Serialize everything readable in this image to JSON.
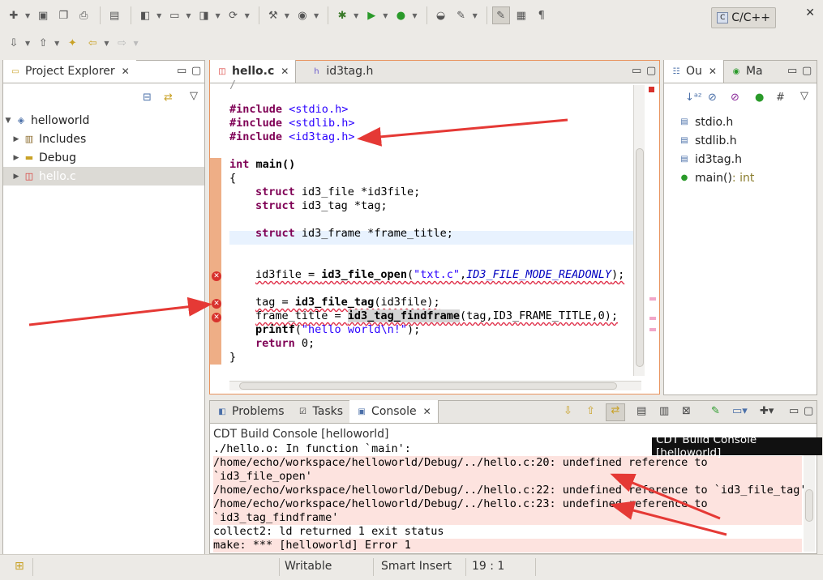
{
  "perspective": {
    "label": "C/C++"
  },
  "project_explorer": {
    "title": "Project Explorer",
    "tree": [
      {
        "label": "helloworld",
        "icon": "c-project-icon"
      },
      {
        "label": "Includes",
        "icon": "includes-icon"
      },
      {
        "label": "Debug",
        "icon": "folder-icon"
      },
      {
        "label": "hello.c",
        "icon": "c-file-error-icon"
      }
    ]
  },
  "editor": {
    "tabs": [
      {
        "label": "hello.c",
        "active": true
      },
      {
        "label": "id3tag.h",
        "active": false
      }
    ],
    "lines": {
      "inc1_kw": "#include",
      "inc1_file": "<stdio.h>",
      "inc2_kw": "#include",
      "inc2_file": "<stdlib.h>",
      "inc3_kw": "#include",
      "inc3_file": "<id3tag.h>",
      "main_kw": "int",
      "main_rest": " main()",
      "open_brace": "{",
      "s1_kw": "struct",
      "s1_rest": " id3_file *id3file;",
      "s2_kw": "struct",
      "s2_rest": " id3_tag *tag;",
      "s3_kw": "struct",
      "s3_rest": " id3_frame *frame_title;",
      "l1_a": "id3file = ",
      "l1_fn": "id3_file_open",
      "l1_b": "(",
      "l1_str": "\"txt.c\"",
      "l1_c": ",",
      "l1_it": "ID3_FILE_MODE_READONLY",
      "l1_d": ");",
      "l2_a": "tag = ",
      "l2_fn": "id3_file_tag",
      "l2_b": "(id3file);",
      "l3_a": "frame_title = ",
      "l3_fn": "id3_tag_findframe",
      "l3_b": "(tag,ID3_FRAME_TITLE,0);",
      "l4_fn": "printf",
      "l4_b": "(",
      "l4_str": "\"hello world\\n!\"",
      "l4_c": ");",
      "l5_kw": "return",
      "l5_rest": " 0;",
      "close_brace": "}"
    }
  },
  "outline": {
    "tabs": [
      {
        "label": "Ou"
      },
      {
        "label": "Ma"
      }
    ],
    "items": [
      {
        "label": "stdio.h",
        "type": ""
      },
      {
        "label": "stdlib.h",
        "type": ""
      },
      {
        "label": "id3tag.h",
        "type": ""
      },
      {
        "label": "main()",
        "type": " : int"
      }
    ]
  },
  "console": {
    "tabs": [
      {
        "label": "Problems"
      },
      {
        "label": "Tasks"
      },
      {
        "label": "Console"
      }
    ],
    "label": "CDT Build Console [helloworld]",
    "lines": [
      {
        "text": "./hello.o: In function `main':",
        "error": false
      },
      {
        "text": "/home/echo/workspace/helloworld/Debug/../hello.c:20: undefined reference to",
        "error": true
      },
      {
        "text": "`id3_file_open'",
        "error": true
      },
      {
        "text": "/home/echo/workspace/helloworld/Debug/../hello.c:22: undefined reference to `id3_file_tag'",
        "error": true
      },
      {
        "text": "/home/echo/workspace/helloworld/Debug/../hello.c:23: undefined reference to",
        "error": true
      },
      {
        "text": "`id3_tag_findframe'",
        "error": true
      },
      {
        "text": "collect2: ld returned 1 exit status",
        "error": false
      },
      {
        "text": "make: *** [helloworld] Error 1",
        "error": true
      }
    ],
    "tooltip": "CDT Build Console [helloworld]"
  },
  "status": {
    "writable": "Writable",
    "insert": "Smart Insert",
    "position": "19 : 1"
  },
  "colors": {
    "error": "#d8322d",
    "keyword": "#7f0055",
    "string": "#2a00ff",
    "arrow": "#e53935"
  }
}
